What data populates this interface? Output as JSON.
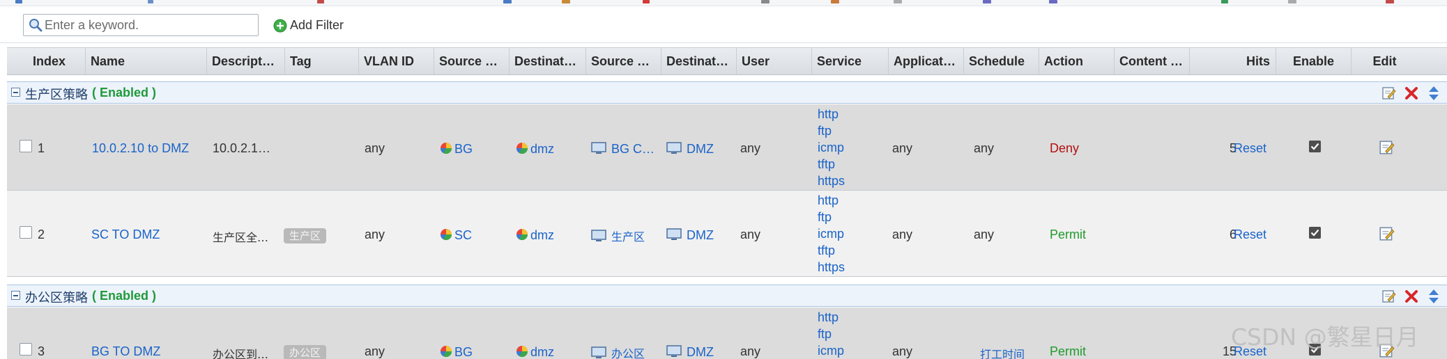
{
  "toolbar": {
    "search_placeholder": "Enter a keyword.",
    "add_filter_label": "Add Filter"
  },
  "columns": [
    {
      "key": "index",
      "label": "Index"
    },
    {
      "key": "name",
      "label": "Name"
    },
    {
      "key": "description",
      "label": "Descript…"
    },
    {
      "key": "tag",
      "label": "Tag"
    },
    {
      "key": "vlan",
      "label": "VLAN ID"
    },
    {
      "key": "source_zone",
      "label": "Source …"
    },
    {
      "key": "dest_zone",
      "label": "Destinat…"
    },
    {
      "key": "source_addr",
      "label": "Source …"
    },
    {
      "key": "dest_addr",
      "label": "Destinat…"
    },
    {
      "key": "user",
      "label": "User"
    },
    {
      "key": "service",
      "label": "Service"
    },
    {
      "key": "application",
      "label": "Applicat…"
    },
    {
      "key": "schedule",
      "label": "Schedule"
    },
    {
      "key": "action",
      "label": "Action"
    },
    {
      "key": "content",
      "label": "Content …"
    },
    {
      "key": "hits",
      "label": "Hits"
    },
    {
      "key": "enable",
      "label": "Enable"
    },
    {
      "key": "edit",
      "label": "Edit"
    }
  ],
  "groups": [
    {
      "name": "生产区策略",
      "status": "( Enabled )",
      "rows": [
        {
          "index": "1",
          "name": "10.0.2.10 to DMZ",
          "description": "10.0.2.1…",
          "tag": "",
          "vlan": "any",
          "source_zone": "BG",
          "dest_zone": "dmz",
          "source_addr": "BG C…",
          "dest_addr": "DMZ",
          "user": "any",
          "services": [
            "http",
            "ftp",
            "icmp",
            "tftp",
            "https"
          ],
          "application": "any",
          "schedule": "any",
          "action": "Deny",
          "hits": "5",
          "reset": "Reset",
          "enabled": true
        },
        {
          "index": "2",
          "name": "SC TO DMZ",
          "description": "生产区全…",
          "tag": "生产区",
          "vlan": "any",
          "source_zone": "SC",
          "dest_zone": "dmz",
          "source_addr": "生产区",
          "dest_addr": "DMZ",
          "user": "any",
          "services": [
            "http",
            "ftp",
            "icmp",
            "tftp",
            "https"
          ],
          "application": "any",
          "schedule": "any",
          "action": "Permit",
          "hits": "6",
          "reset": "Reset",
          "enabled": true
        }
      ]
    },
    {
      "name": "办公区策略",
      "status": "( Enabled )",
      "rows": [
        {
          "index": "3",
          "name": "BG TO DMZ",
          "description": "办公区到…",
          "tag": "办公区",
          "vlan": "any",
          "source_zone": "BG",
          "dest_zone": "dmz",
          "source_addr": "办公区",
          "dest_addr": "DMZ",
          "user": "any",
          "services": [
            "http",
            "ftp",
            "icmp"
          ],
          "application": "any",
          "schedule": "打工时间",
          "action": "Permit",
          "hits": "15",
          "reset": "Reset",
          "enabled": true
        }
      ]
    }
  ],
  "watermark": "CSDN @繁星日月",
  "colors": {
    "link": "#1a63c9",
    "deny": "#b31010",
    "permit": "#1f9a2a",
    "enabled": "#1f9a3a"
  }
}
